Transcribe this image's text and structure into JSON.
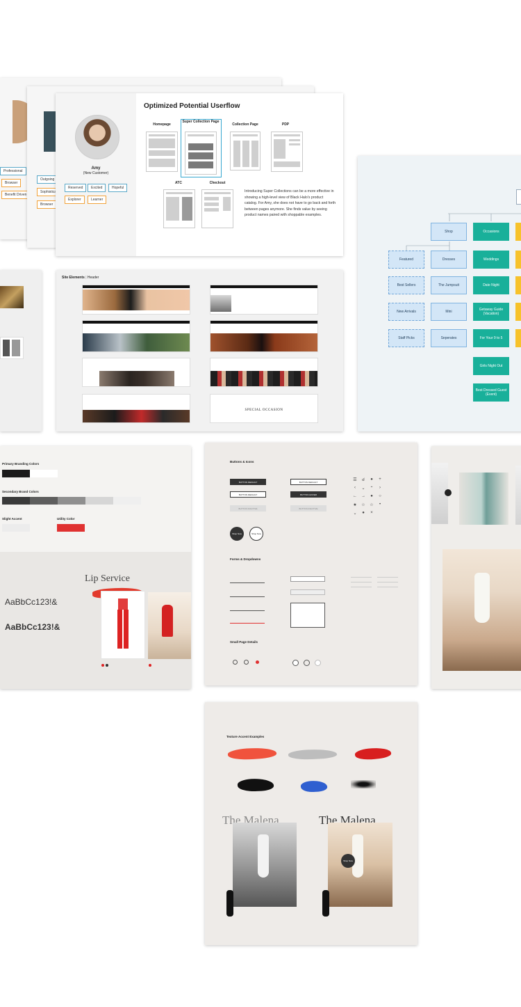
{
  "userflow": {
    "title": "Optimized Potential Userflow",
    "persona_name": "Amy",
    "persona_role": "(New Customer)",
    "traits": [
      "Reserved",
      "Excited",
      "Hopeful",
      "Explorer",
      "Learner"
    ],
    "pages": {
      "homepage": "Homepage",
      "super_collection": "Super Collection Page",
      "collection": "Collection Page",
      "pdp": "PDP",
      "atc": "ATC",
      "checkout": "Checkout"
    },
    "description": "Introducing Super Collections can be a more effective in showing a high-level view of Black Halo's product catalog. For Amy, she does not have to go back and forth between pages anymore. She finds value by seeing product names paired with shoppable examples.",
    "back_card_1_traits": [
      "Professional",
      "Browser",
      "Benefit Driven"
    ],
    "back_card_2_traits": [
      "Outgoing",
      "Sophisticated",
      "Browser"
    ]
  },
  "site_elements": {
    "title": "Site Elements",
    "subtitle": "Header",
    "special_occasion": "SPECIAL OCCASION"
  },
  "sitemap": {
    "shop": "Shop",
    "occasions": "Occasions",
    "shop_children": [
      "Featured",
      "Best Sellers",
      "New Arrivals",
      "Staff Picks"
    ],
    "dresses_children": [
      "Dresses",
      "The Jumpsuit",
      "Mini",
      "Seperates"
    ],
    "occasion_children": [
      "Weddings",
      "Date Night",
      "Getaway Guide (Vacation)",
      "For Your 9 to 5",
      "Girls Night Out",
      "Best Dressed Guest (Event)"
    ]
  },
  "brand": {
    "primary_title": "Primary Branding Colors",
    "secondary_title": "Secondary Brand Colors",
    "slight_accent": "Slight Accent",
    "utility_color": "Utility Color",
    "lip_service": "Lip Service",
    "sample_1": "AaBbCc123!&",
    "sample_2": "AaBbCc123!&",
    "primary_colors": [
      "#1b1b1b",
      "#ffffff"
    ],
    "secondary_colors": [
      "#3a3a3a",
      "#5e5e5e",
      "#8f8f8f",
      "#d6d6d6",
      "#efefef"
    ],
    "utility_hex": "#e03131"
  },
  "components": {
    "buttons_title": "Buttons & Icons",
    "forms_title": "Forms & Dropdowns",
    "small_page_title": "Small Page Details",
    "btn_default": "BUTTON DEFAULT",
    "btn_hover": "BUTTON HOVER",
    "btn_inactive": "BUTTON INACTIVE",
    "shop_now": "Shop Now"
  },
  "texture": {
    "title": "Texture Accent Examples",
    "malena_1": "The Malena",
    "malena_2": "The Malena",
    "stroke_colors": [
      "#f0533d",
      "#bdbdbd",
      "#d81f1f",
      "#111111",
      "#2f5fd0",
      "#2a2a2a"
    ]
  }
}
